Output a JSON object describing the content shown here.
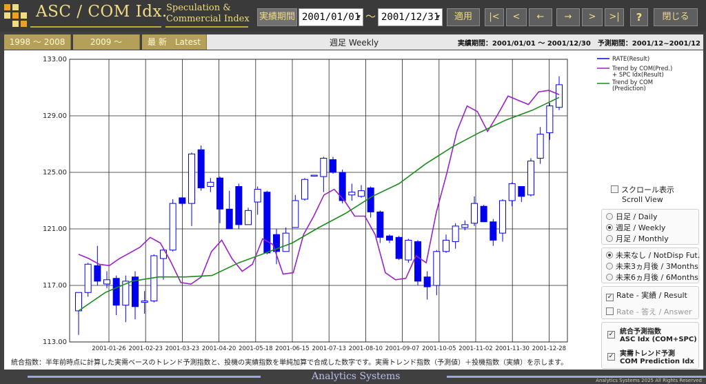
{
  "header": {
    "title": "ASC / COM Idx.",
    "subtitle_line1": "Speculation &",
    "subtitle_line2": "Commercial Index",
    "period_label": "実績期間",
    "date_from": "2001/01/01",
    "date_to": "2001/12/31",
    "tilde": "～",
    "apply_label": "適用",
    "nav_first": "|<",
    "nav_prev": "<",
    "nav_back": "←",
    "nav_fwd": "→",
    "nav_next": ">",
    "nav_last": ">|",
    "help_label": "?",
    "close_label": "閉じる"
  },
  "periods": {
    "btn1": "1998 ～ 2008",
    "btn2": "2009 ～",
    "btn3": "最 新　Latest",
    "view_title": "週足  Weekly",
    "info": "実績期間：2001/01/01 ～ 2001/12/30　予測期間：2001/12~2001/12"
  },
  "colors": {
    "rate": "#0000ee",
    "trend_pred": "#9a20c8",
    "trend_com": "#1a8c1a",
    "accent": "#f0dc82"
  },
  "chart_data": {
    "type": "candlestick",
    "y_ticks": [
      "133.00",
      "129.00",
      "125.00",
      "121.00",
      "117.00",
      "113.00"
    ],
    "ylim": [
      113,
      133
    ],
    "x_labels": [
      "2001-01-26",
      "2001-02-23",
      "2001-03-23",
      "2001-04-20",
      "2001-05-18",
      "2001-06-15",
      "2001-07-13",
      "2001-08-10",
      "2001-09-07",
      "2001-10-05",
      "2001-11-02",
      "2001-11-30",
      "2001-12-28"
    ],
    "legend": [
      "RATE(Result)",
      "Trend by COM(Pred.)",
      "+ SPC Idx(Result)",
      "Trend by COM",
      "(Prediction)"
    ],
    "candles": [
      [
        115.2,
        116.5,
        114.5,
        113.5
      ],
      [
        116.5,
        118.5,
        118.6,
        116.2
      ],
      [
        118.4,
        117.3,
        119.8,
        117.0
      ],
      [
        117.1,
        117.4,
        118.0,
        116.8
      ],
      [
        117.5,
        115.6,
        117.7,
        114.9
      ],
      [
        115.6,
        117.3,
        117.7,
        114.4
      ],
      [
        117.6,
        115.5,
        118.0,
        114.6
      ],
      [
        115.8,
        115.9,
        116.6,
        115.0
      ],
      [
        115.9,
        119.1,
        119.2,
        115.8
      ],
      [
        118.9,
        119.5,
        119.6,
        117.4
      ],
      [
        119.5,
        122.8,
        123.1,
        119.4
      ],
      [
        123.2,
        122.8,
        123.2,
        122.6
      ],
      [
        122.8,
        126.3,
        126.4,
        121.2
      ],
      [
        126.6,
        123.9,
        126.9,
        123.7
      ],
      [
        124.0,
        124.3,
        124.6,
        123.6
      ],
      [
        124.6,
        122.4,
        124.7,
        121.4
      ],
      [
        122.4,
        121.0,
        123.7,
        121.6
      ],
      [
        124.0,
        121.3,
        124.2,
        121.0
      ],
      [
        121.3,
        122.3,
        122.5,
        121.4
      ],
      [
        122.9,
        123.8,
        124.0,
        122.0
      ],
      [
        123.6,
        119.3,
        123.7,
        119.2
      ],
      [
        120.6,
        119.4,
        121.0,
        118.5
      ],
      [
        119.4,
        120.7,
        121.1,
        119.5
      ],
      [
        121.1,
        123.0,
        123.4,
        121.2
      ],
      [
        123.1,
        124.5,
        124.6,
        123.0
      ],
      [
        124.8,
        124.8,
        124.8,
        124.8
      ],
      [
        124.7,
        126.0,
        126.1,
        123.6
      ],
      [
        125.9,
        125.0,
        126.1,
        124.9
      ],
      [
        125.0,
        123.0,
        125.2,
        122.8
      ],
      [
        123.4,
        123.6,
        124.2,
        123.0
      ],
      [
        123.3,
        123.7,
        124.1,
        123.2
      ],
      [
        123.9,
        122.2,
        124.0,
        121.8
      ],
      [
        122.2,
        120.4,
        122.3,
        120.0
      ],
      [
        120.5,
        120.2,
        120.6,
        120.0
      ],
      [
        120.4,
        118.9,
        120.5,
        118.8
      ],
      [
        118.8,
        120.2,
        120.3,
        118.6
      ],
      [
        120.1,
        117.3,
        120.2,
        117.0
      ],
      [
        117.6,
        116.9,
        118.0,
        116.0
      ],
      [
        117.0,
        119.4,
        119.5,
        116.3
      ],
      [
        119.4,
        120.2,
        120.6,
        119.3
      ],
      [
        120.1,
        121.2,
        121.4,
        119.6
      ],
      [
        121.1,
        121.3,
        121.6,
        120.9
      ],
      [
        121.4,
        122.8,
        123.3,
        121.2
      ],
      [
        122.6,
        121.5,
        122.7,
        121.5
      ],
      [
        121.5,
        120.2,
        121.7,
        119.8
      ],
      [
        120.7,
        123.0,
        123.1,
        120.1
      ],
      [
        123.0,
        124.2,
        124.3,
        122.6
      ],
      [
        124.0,
        123.3,
        124.0,
        122.9
      ],
      [
        123.4,
        125.8,
        126.0,
        123.3
      ],
      [
        126.0,
        127.7,
        128.2,
        125.6
      ],
      [
        127.8,
        129.7,
        129.9,
        127.3
      ],
      [
        129.6,
        131.2,
        131.8,
        129.4
      ]
    ],
    "trend_pred": [
      119.2,
      118.9,
      118.5,
      118.4,
      118.9,
      119.3,
      119.7,
      120.4,
      120.0,
      118.7,
      117.2,
      117.1,
      117.6,
      119.4,
      120.2,
      118.9,
      118.0,
      118.5,
      120.3,
      119.9,
      117.8,
      117.9,
      120.6,
      121.9,
      123.4,
      123.8,
      123.0,
      121.9,
      121.9,
      120.6,
      117.9,
      117.4,
      117.5,
      119.1,
      118.6,
      122.2,
      124.9,
      127.9,
      129.7,
      129.3,
      127.9,
      129.1,
      130.4,
      130.1,
      129.8,
      130.7,
      130.8,
      130.5
    ],
    "trend_com": [
      115.2,
      116.5,
      117.3,
      117.6,
      117.6,
      117.7,
      118.6,
      119.3,
      120.0,
      121.1,
      122.1,
      123.3,
      124.2,
      125.6,
      126.8,
      127.8,
      128.7,
      129.4,
      130.3
    ]
  },
  "footnote": "統合指数：半年前時点に計算した実需ベースのトレンド予測指数と、投機の実績指数を単純加算で合成した数字です。実需トレンド指数（予測値）＋投機指数（実績）を示します。",
  "side": {
    "scroll_ja": "スクロール表示",
    "scroll_en": "Scroll View",
    "daily": "日足 / Daily",
    "weekly": "週足 / Weekly",
    "monthly": "月足 / Monthly",
    "fut_none": "未来なし / NotDisp Fut.",
    "fut_3m": "未来3ヵ月後 / 3Months",
    "fut_6m": "未来6ヵ月後 / 6Months",
    "rate_result": "Rate - 実績 / Result",
    "rate_answer": "Rate - 答え / Answer",
    "asc_ja": "統合予測指数",
    "asc_en": "ASC Idx (COM+SPC)",
    "com_ja": "実需トレンド予測",
    "com_en": "COM Prediction Idx",
    "check": "✓"
  },
  "footer": {
    "brand": "Analytics Systems",
    "copyright": "Analytics Systems 2025 All Rights Reserved"
  }
}
